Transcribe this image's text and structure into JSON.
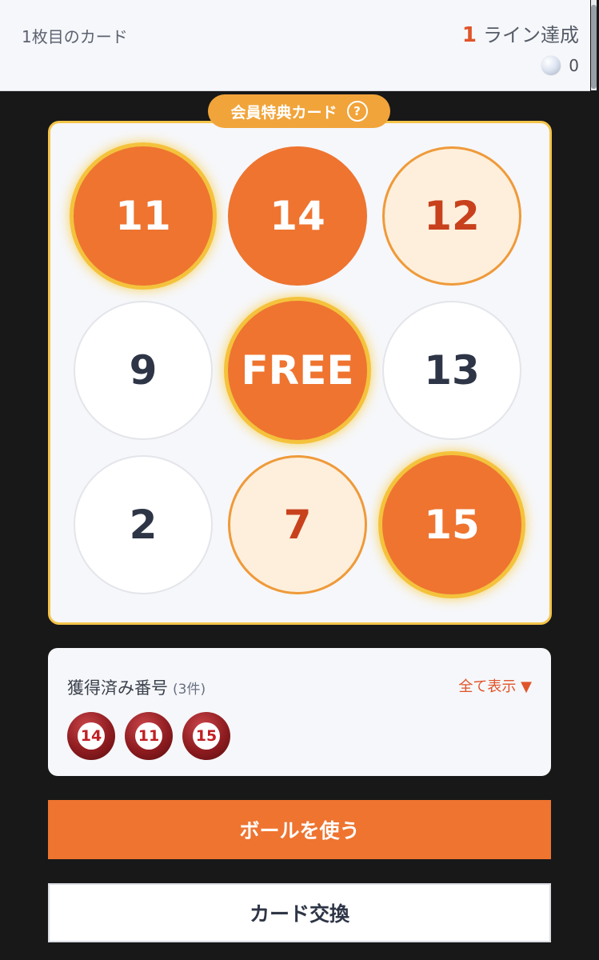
{
  "header": {
    "card_label": "1枚目のカード",
    "line_count": "1",
    "line_label": "ライン達成",
    "coins": "0"
  },
  "card": {
    "badge": "会員特典カード",
    "help": "?",
    "cells": [
      {
        "label": "11",
        "state": "marked",
        "glow": true
      },
      {
        "label": "14",
        "state": "marked",
        "glow": false
      },
      {
        "label": "12",
        "state": "partial",
        "glow": false
      },
      {
        "label": "9",
        "state": "plain",
        "glow": false
      },
      {
        "label": "FREE",
        "state": "marked",
        "glow": true
      },
      {
        "label": "13",
        "state": "plain",
        "glow": false
      },
      {
        "label": "2",
        "state": "plain",
        "glow": false
      },
      {
        "label": "7",
        "state": "partial",
        "glow": false
      },
      {
        "label": "15",
        "state": "marked",
        "glow": true
      }
    ]
  },
  "acquired": {
    "title": "獲得済み番号",
    "count": "(3件)",
    "show_all": "全て表示 ▼",
    "balls": [
      "14",
      "11",
      "15"
    ]
  },
  "buttons": {
    "use_ball": "ボールを使う",
    "exchange_card": "カード交換"
  },
  "colors": {
    "accent": "#ee7430",
    "highlight": "#e0542a",
    "glow": "#f4c23c",
    "badge": "#f1a43a"
  }
}
